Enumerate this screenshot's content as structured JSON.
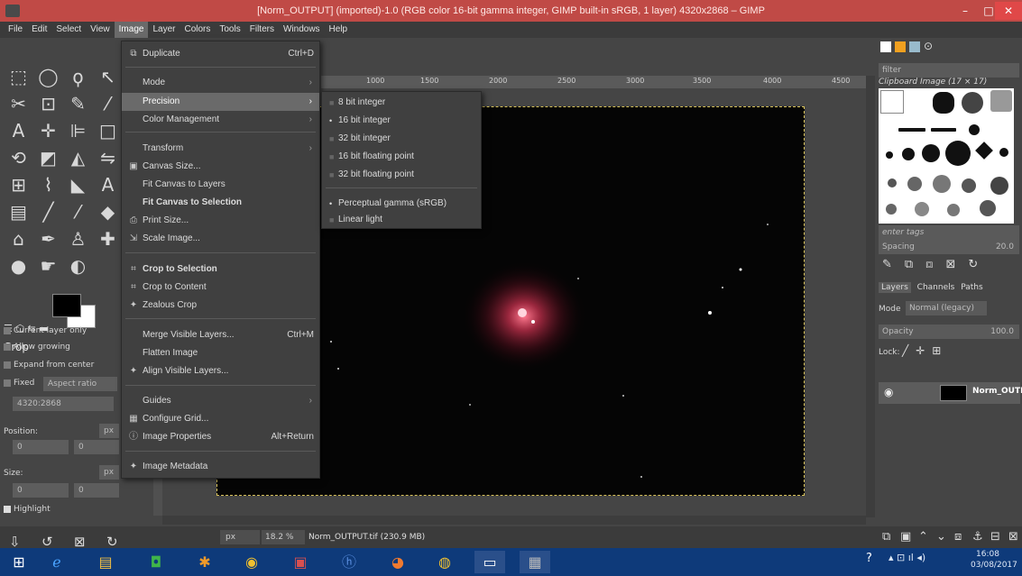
{
  "window": {
    "title": "[Norm_OUTPUT] (imported)-1.0 (RGB color 16-bit gamma integer, GIMP built-in sRGB, 1 layer) 4320x2868 – GIMP",
    "minimize": "–",
    "maximize": "□",
    "close": "✕"
  },
  "menubar": [
    "File",
    "Edit",
    "Select",
    "View",
    "Image",
    "Layer",
    "Colors",
    "Tools",
    "Filters",
    "Windows",
    "Help"
  ],
  "image_menu": {
    "items": [
      {
        "label": "Duplicate",
        "accel": "Ctrl+D",
        "icon": "⧉"
      },
      {
        "label": "Mode",
        "submenu": true
      },
      {
        "label": "Precision",
        "submenu": true,
        "highlighted": true
      },
      {
        "label": "Color Management",
        "submenu": true
      },
      {
        "label": "Transform",
        "submenu": true
      },
      {
        "label": "Canvas Size...",
        "icon": "▣"
      },
      {
        "label": "Fit Canvas to Layers"
      },
      {
        "label": "Fit Canvas to Selection",
        "bold": true
      },
      {
        "label": "Print Size...",
        "icon": "⎙"
      },
      {
        "label": "Scale Image...",
        "icon": "⇲"
      },
      {
        "label": "Crop to Selection",
        "icon": "⌗"
      },
      {
        "label": "Crop to Content",
        "icon": "⌗"
      },
      {
        "label": "Zealous Crop",
        "icon": "✦"
      },
      {
        "label": "Merge Visible Layers...",
        "accel": "Ctrl+M"
      },
      {
        "label": "Flatten Image"
      },
      {
        "label": "Align Visible Layers...",
        "icon": "✦"
      },
      {
        "label": "Guides",
        "submenu": true
      },
      {
        "label": "Configure Grid...",
        "icon": "▦"
      },
      {
        "label": "Image Properties",
        "accel": "Alt+Return",
        "icon": "ⓘ"
      },
      {
        "label": "Image Metadata",
        "icon": "✦"
      }
    ]
  },
  "precision_menu": {
    "items": [
      {
        "label": "8 bit integer",
        "selected": false
      },
      {
        "label": "16 bit integer",
        "selected": true
      },
      {
        "label": "32 bit integer",
        "selected": false
      },
      {
        "label": "16 bit floating point",
        "selected": false
      },
      {
        "label": "32 bit floating point",
        "selected": false
      },
      {
        "label": "Perceptual gamma (sRGB)",
        "selected": true
      },
      {
        "label": "Linear light",
        "selected": false
      }
    ]
  },
  "ruler": {
    "ticks": [
      "1000",
      "1500",
      "2000",
      "2500",
      "3000",
      "3500",
      "4000",
      "4500"
    ]
  },
  "tool_options": {
    "title": "Crop",
    "current_layer_only": "Current layer only",
    "allow_growing": "Allow growing",
    "expand_from_center": "Expand from center",
    "fixed": "Fixed",
    "aspect_ratio": "Aspect ratio",
    "ratio_value": "4320:2868",
    "position_label": "Position:",
    "size_label": "Size:",
    "unit": "px",
    "zero": "0",
    "highlight": "Highlight"
  },
  "statusbar": {
    "unit": "px",
    "zoom": "18.2 %",
    "file": "Norm_OUTPUT.tif (230.9 MB)"
  },
  "dock": {
    "filter_placeholder": "filter",
    "brush_name": "Clipboard Image (17 × 17)",
    "tags_placeholder": "enter tags",
    "spacing_label": "Spacing",
    "spacing_value": "20.0",
    "tabs": [
      "Layers",
      "Channels",
      "Paths"
    ],
    "mode_label": "Mode",
    "mode_value": "Normal (legacy)",
    "opacity_label": "Opacity",
    "opacity_value": "100.0",
    "lock_label": "Lock:",
    "layer_name": "Norm_OUTPU"
  },
  "taskbar": {
    "time": "16:08",
    "date": "03/08/2017"
  },
  "colors": {
    "accent": "#c04a46",
    "menu_bg": "#404040",
    "highlight": "#6a6a6a"
  }
}
